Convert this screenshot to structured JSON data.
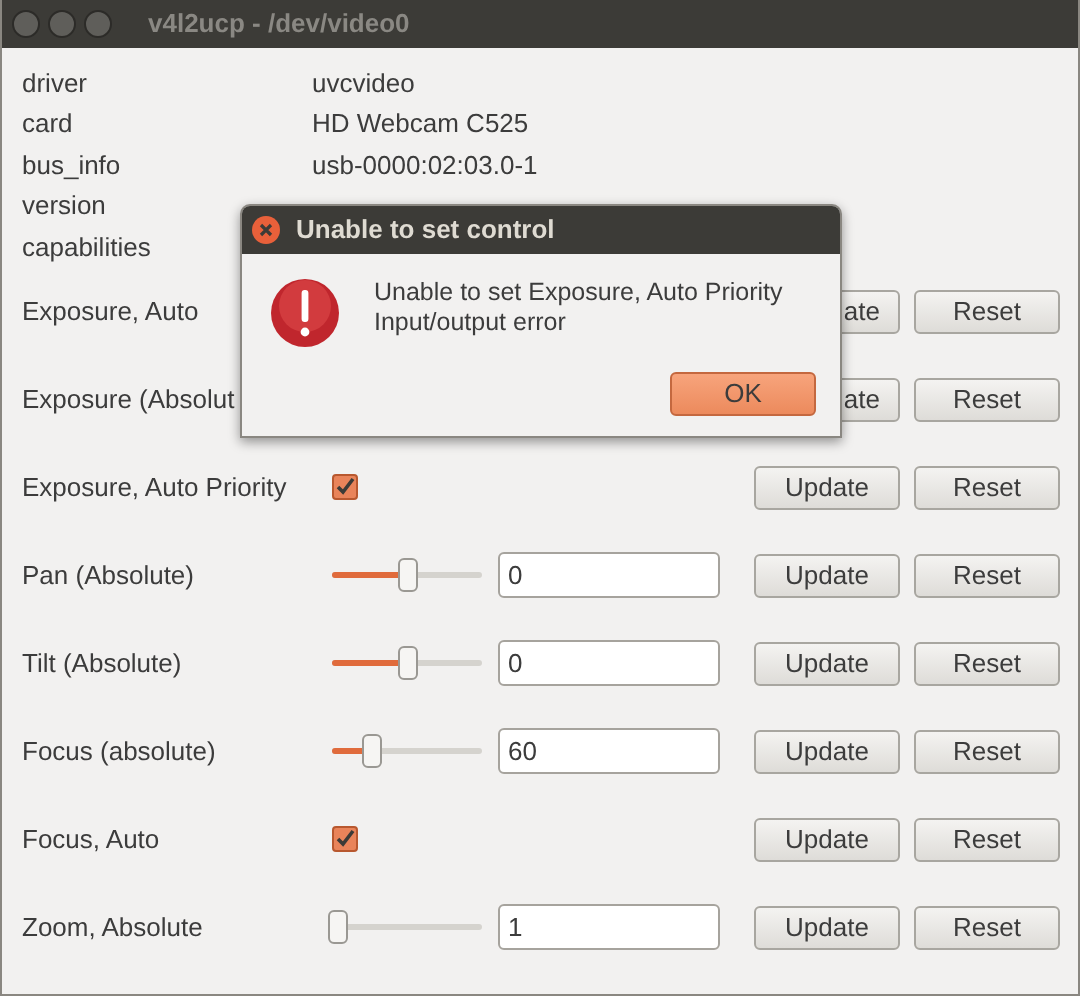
{
  "window": {
    "title": "v4l2ucp - /dev/video0"
  },
  "info": [
    {
      "label": "driver",
      "value": "uvcvideo"
    },
    {
      "label": "card",
      "value": "HD Webcam C525"
    },
    {
      "label": "bus_info",
      "value": "usb-0000:02:03.0-1"
    },
    {
      "label": "version"
    },
    {
      "label": "capabilities"
    }
  ],
  "controls": [
    {
      "label": "Exposure, Auto",
      "update": "ate",
      "update_covered": true,
      "reset": "Reset"
    },
    {
      "label": "Exposure (Absolut",
      "update": "ate",
      "update_covered": true,
      "reset": "Reset"
    },
    {
      "label": "Exposure, Auto Priority",
      "kind": "checkbox",
      "checked": true,
      "update": "Update",
      "reset": "Reset"
    },
    {
      "label": "Pan (Absolute)",
      "kind": "slider",
      "level": 0.5,
      "value": "0",
      "update": "Update",
      "reset": "Reset"
    },
    {
      "label": "Tilt (Absolute)",
      "kind": "slider",
      "level": 0.5,
      "value": "0",
      "update": "Update",
      "reset": "Reset"
    },
    {
      "label": "Focus (absolute)",
      "kind": "slider",
      "level": 0.27,
      "value": "60",
      "update": "Update",
      "reset": "Reset"
    },
    {
      "label": "Focus, Auto",
      "kind": "checkbox",
      "checked": true,
      "update": "Update",
      "reset": "Reset"
    },
    {
      "label": "Zoom, Absolute",
      "kind": "slider",
      "level": 0.04,
      "value": "1",
      "update": "Update",
      "reset": "Reset"
    }
  ],
  "dialog": {
    "title": "Unable to set control",
    "message": "Unable to set Exposure, Auto Priority",
    "detail": "Input/output error",
    "ok": "OK"
  }
}
